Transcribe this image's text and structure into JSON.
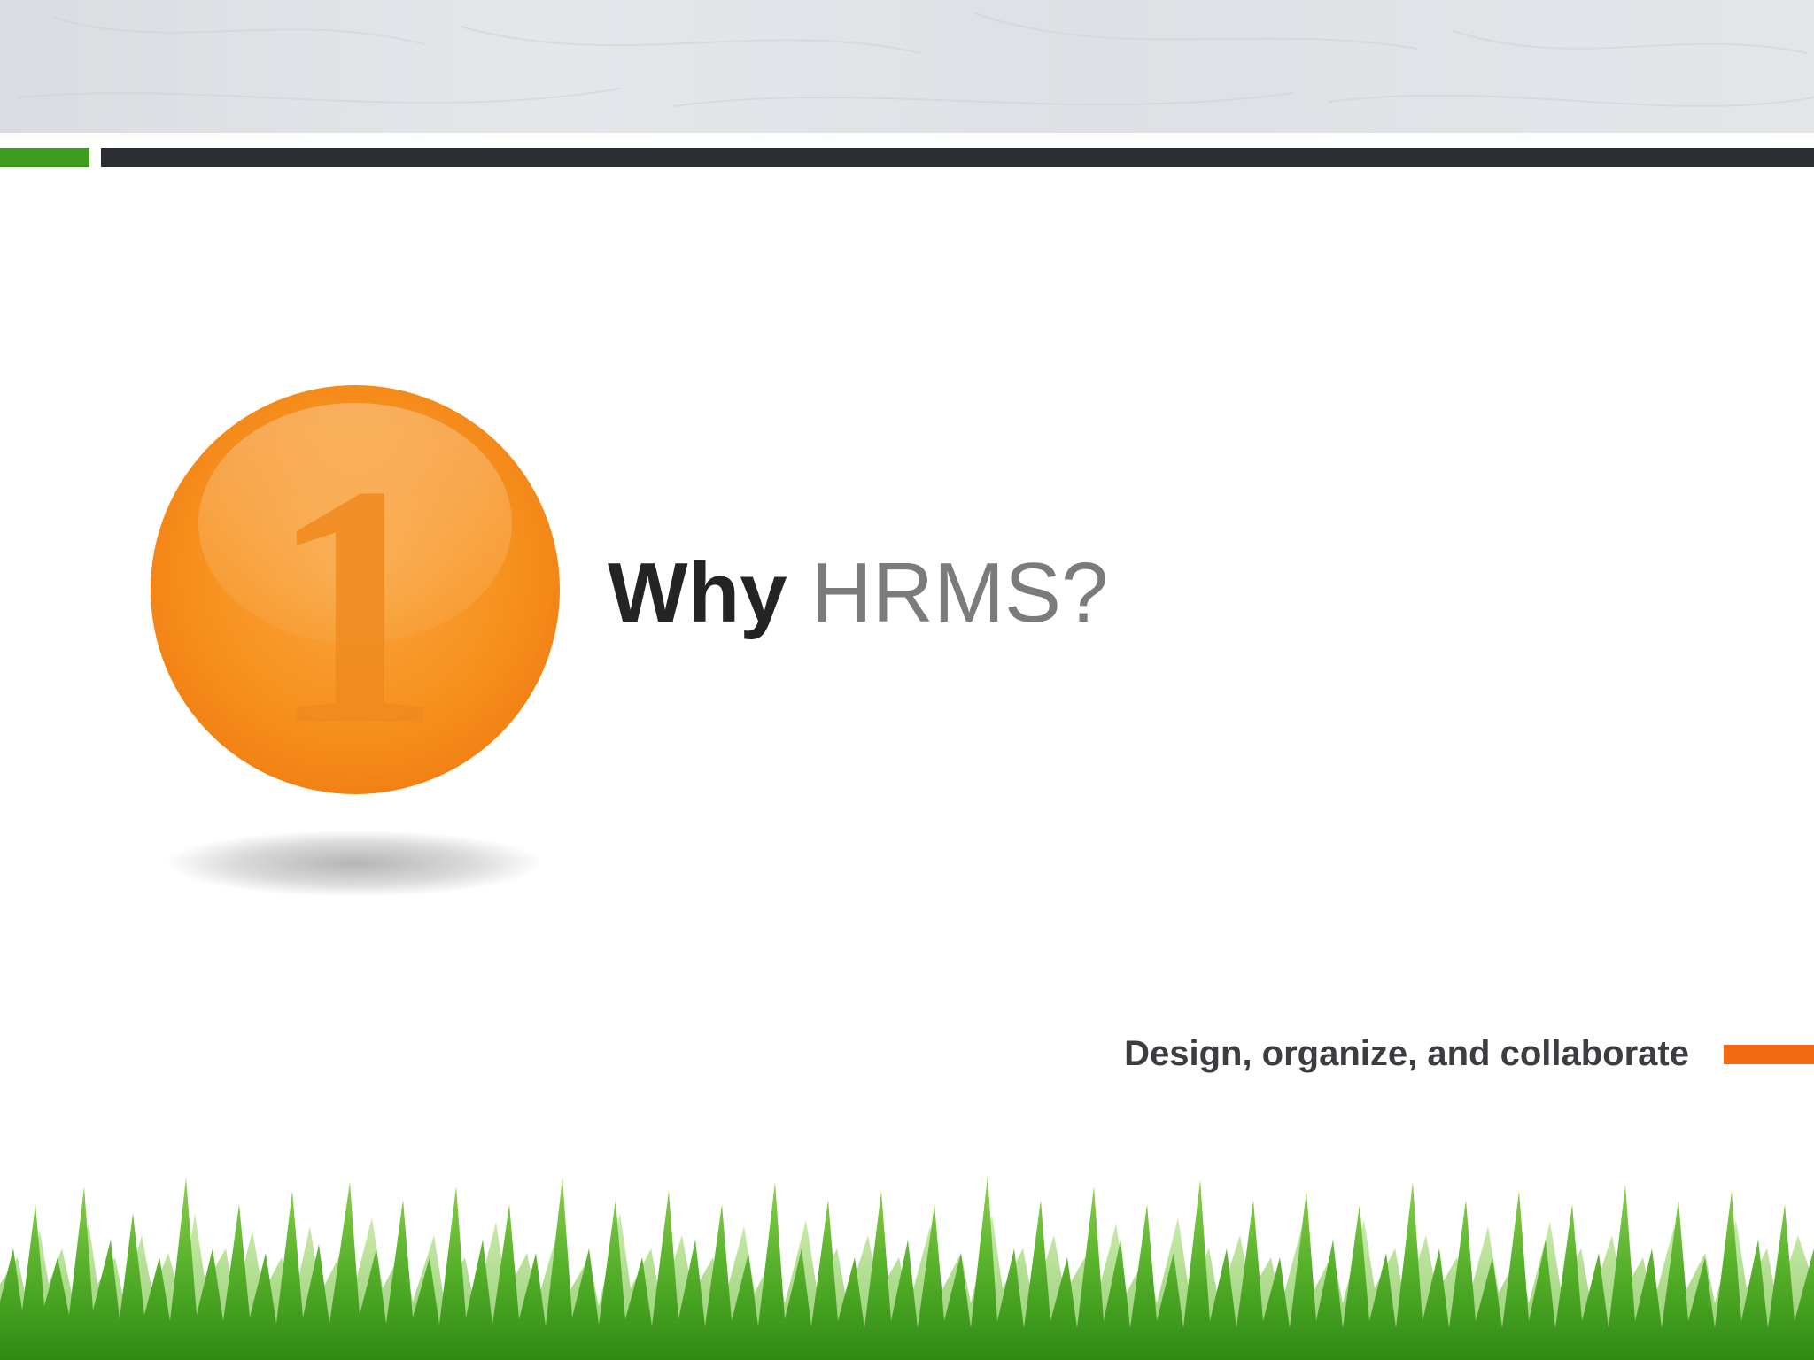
{
  "slide": {
    "number": "1",
    "title_bold": "Why",
    "title_light": "HRMS?",
    "subtitle": "Design, organize, and collaborate"
  },
  "colors": {
    "accent_orange": "#f58a1f",
    "accent_green": "#3f9c1f",
    "dark_bar": "#2a2e33",
    "title_dark": "#242424",
    "title_gray": "#7b7b7b"
  }
}
